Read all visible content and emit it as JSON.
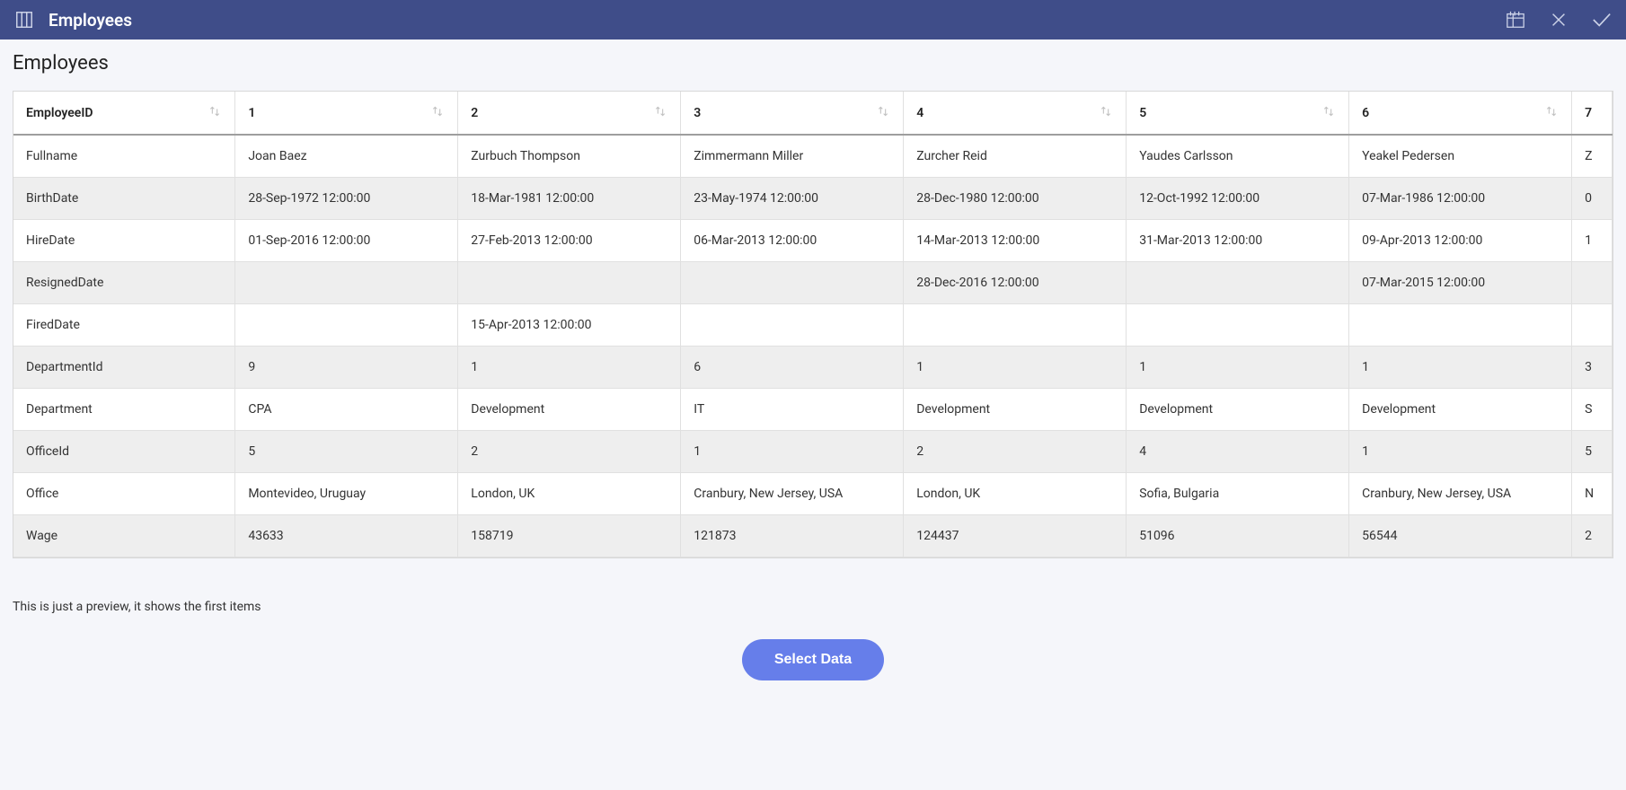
{
  "topbar": {
    "title": "Employees"
  },
  "page": {
    "title": "Employees",
    "preview_note": "This is just a preview, it shows the first items",
    "select_button": "Select Data"
  },
  "grid": {
    "headers": [
      "EmployeeID",
      "1",
      "2",
      "3",
      "4",
      "5",
      "6",
      "7"
    ],
    "rows": [
      {
        "label": "Fullname",
        "cells": [
          "Joan Baez",
          "Zurbuch Thompson",
          "Zimmermann Miller",
          "Zurcher Reid",
          "Yaudes Carlsson",
          "Yeakel Pedersen",
          "Z"
        ]
      },
      {
        "label": "BirthDate",
        "cells": [
          "28-Sep-1972 12:00:00",
          "18-Mar-1981 12:00:00",
          "23-May-1974 12:00:00",
          "28-Dec-1980 12:00:00",
          "12-Oct-1992 12:00:00",
          "07-Mar-1986 12:00:00",
          "0"
        ]
      },
      {
        "label": "HireDate",
        "cells": [
          "01-Sep-2016 12:00:00",
          "27-Feb-2013 12:00:00",
          "06-Mar-2013 12:00:00",
          "14-Mar-2013 12:00:00",
          "31-Mar-2013 12:00:00",
          "09-Apr-2013 12:00:00",
          "1"
        ]
      },
      {
        "label": "ResignedDate",
        "cells": [
          "",
          "",
          "",
          "28-Dec-2016 12:00:00",
          "",
          "07-Mar-2015 12:00:00",
          ""
        ]
      },
      {
        "label": "FiredDate",
        "cells": [
          "",
          "15-Apr-2013 12:00:00",
          "",
          "",
          "",
          "",
          ""
        ]
      },
      {
        "label": "DepartmentId",
        "cells": [
          "9",
          "1",
          "6",
          "1",
          "1",
          "1",
          "3"
        ]
      },
      {
        "label": "Department",
        "cells": [
          "CPA",
          "Development",
          "IT",
          "Development",
          "Development",
          "Development",
          "S"
        ]
      },
      {
        "label": "OfficeId",
        "cells": [
          "5",
          "2",
          "1",
          "2",
          "4",
          "1",
          "5"
        ]
      },
      {
        "label": "Office",
        "cells": [
          "Montevideo, Uruguay",
          "London, UK",
          "Cranbury, New Jersey, USA",
          "London, UK",
          "Sofia, Bulgaria",
          "Cranbury, New Jersey, USA",
          "N"
        ]
      },
      {
        "label": "Wage",
        "cells": [
          "43633",
          "158719",
          "121873",
          "124437",
          "51096",
          "56544",
          "2"
        ]
      }
    ]
  }
}
